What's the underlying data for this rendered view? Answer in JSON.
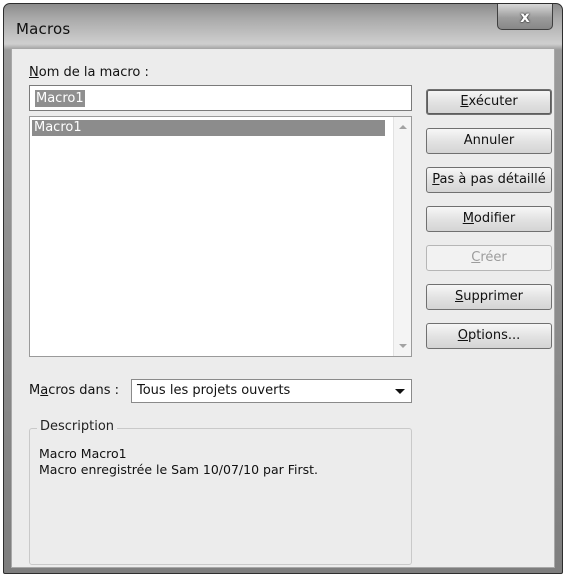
{
  "window": {
    "title": "Macros",
    "close_glyph": "x"
  },
  "macro_name": {
    "label_u": "N",
    "label_rest": "om de la macro :",
    "value": "Macro1"
  },
  "macro_list": {
    "items": [
      "Macro1"
    ],
    "selected": "Macro1"
  },
  "macros_in": {
    "label_pre": "M",
    "label_u": "a",
    "label_rest": "cros dans :",
    "value": "Tous les projets ouverts"
  },
  "description": {
    "title": "Description",
    "line1": "Macro Macro1",
    "line2": "Macro enregistrée le Sam 10/07/10 par First."
  },
  "buttons": {
    "executer": {
      "u": "E",
      "rest": "xécuter"
    },
    "annuler": {
      "label": "Annuler"
    },
    "pas_a_pas": {
      "u": "P",
      "rest": "as à pas détaillé"
    },
    "modifier": {
      "u": "M",
      "rest": "odifier"
    },
    "creer": {
      "u": "C",
      "rest": "réer",
      "disabled": true
    },
    "supprimer": {
      "u": "S",
      "rest": "upprimer"
    },
    "options": {
      "u": "O",
      "rest": "ptions..."
    }
  },
  "icons": {
    "close": "close-icon",
    "scroll_up": "scroll-up-arrow-icon",
    "scroll_down": "scroll-down-arrow-icon",
    "dropdown": "chevron-down-icon"
  }
}
